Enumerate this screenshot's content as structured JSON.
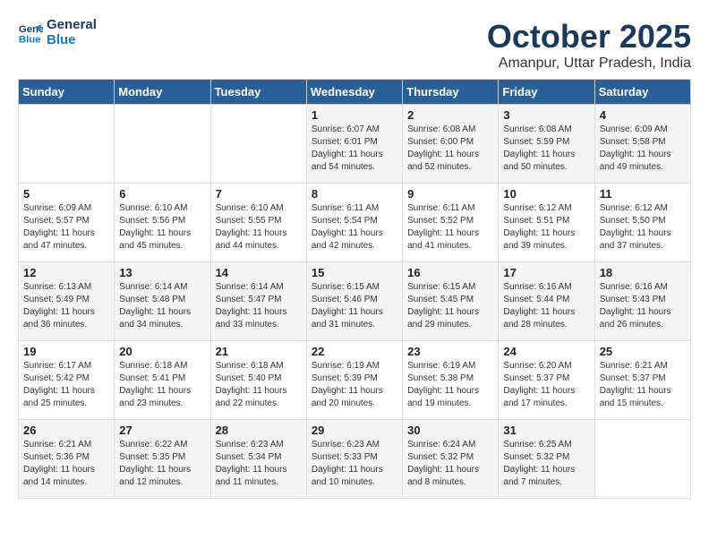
{
  "header": {
    "logo_line1": "General",
    "logo_line2": "Blue",
    "title": "October 2025",
    "subtitle": "Amanpur, Uttar Pradesh, India"
  },
  "days_of_week": [
    "Sunday",
    "Monday",
    "Tuesday",
    "Wednesday",
    "Thursday",
    "Friday",
    "Saturday"
  ],
  "weeks": [
    [
      {
        "day": "",
        "content": ""
      },
      {
        "day": "",
        "content": ""
      },
      {
        "day": "",
        "content": ""
      },
      {
        "day": "1",
        "content": "Sunrise: 6:07 AM\nSunset: 6:01 PM\nDaylight: 11 hours\nand 54 minutes."
      },
      {
        "day": "2",
        "content": "Sunrise: 6:08 AM\nSunset: 6:00 PM\nDaylight: 11 hours\nand 52 minutes."
      },
      {
        "day": "3",
        "content": "Sunrise: 6:08 AM\nSunset: 5:59 PM\nDaylight: 11 hours\nand 50 minutes."
      },
      {
        "day": "4",
        "content": "Sunrise: 6:09 AM\nSunset: 5:58 PM\nDaylight: 11 hours\nand 49 minutes."
      }
    ],
    [
      {
        "day": "5",
        "content": "Sunrise: 6:09 AM\nSunset: 5:57 PM\nDaylight: 11 hours\nand 47 minutes."
      },
      {
        "day": "6",
        "content": "Sunrise: 6:10 AM\nSunset: 5:56 PM\nDaylight: 11 hours\nand 45 minutes."
      },
      {
        "day": "7",
        "content": "Sunrise: 6:10 AM\nSunset: 5:55 PM\nDaylight: 11 hours\nand 44 minutes."
      },
      {
        "day": "8",
        "content": "Sunrise: 6:11 AM\nSunset: 5:54 PM\nDaylight: 11 hours\nand 42 minutes."
      },
      {
        "day": "9",
        "content": "Sunrise: 6:11 AM\nSunset: 5:52 PM\nDaylight: 11 hours\nand 41 minutes."
      },
      {
        "day": "10",
        "content": "Sunrise: 6:12 AM\nSunset: 5:51 PM\nDaylight: 11 hours\nand 39 minutes."
      },
      {
        "day": "11",
        "content": "Sunrise: 6:12 AM\nSunset: 5:50 PM\nDaylight: 11 hours\nand 37 minutes."
      }
    ],
    [
      {
        "day": "12",
        "content": "Sunrise: 6:13 AM\nSunset: 5:49 PM\nDaylight: 11 hours\nand 36 minutes."
      },
      {
        "day": "13",
        "content": "Sunrise: 6:14 AM\nSunset: 5:48 PM\nDaylight: 11 hours\nand 34 minutes."
      },
      {
        "day": "14",
        "content": "Sunrise: 6:14 AM\nSunset: 5:47 PM\nDaylight: 11 hours\nand 33 minutes."
      },
      {
        "day": "15",
        "content": "Sunrise: 6:15 AM\nSunset: 5:46 PM\nDaylight: 11 hours\nand 31 minutes."
      },
      {
        "day": "16",
        "content": "Sunrise: 6:15 AM\nSunset: 5:45 PM\nDaylight: 11 hours\nand 29 minutes."
      },
      {
        "day": "17",
        "content": "Sunrise: 6:16 AM\nSunset: 5:44 PM\nDaylight: 11 hours\nand 28 minutes."
      },
      {
        "day": "18",
        "content": "Sunrise: 6:16 AM\nSunset: 5:43 PM\nDaylight: 11 hours\nand 26 minutes."
      }
    ],
    [
      {
        "day": "19",
        "content": "Sunrise: 6:17 AM\nSunset: 5:42 PM\nDaylight: 11 hours\nand 25 minutes."
      },
      {
        "day": "20",
        "content": "Sunrise: 6:18 AM\nSunset: 5:41 PM\nDaylight: 11 hours\nand 23 minutes."
      },
      {
        "day": "21",
        "content": "Sunrise: 6:18 AM\nSunset: 5:40 PM\nDaylight: 11 hours\nand 22 minutes."
      },
      {
        "day": "22",
        "content": "Sunrise: 6:19 AM\nSunset: 5:39 PM\nDaylight: 11 hours\nand 20 minutes."
      },
      {
        "day": "23",
        "content": "Sunrise: 6:19 AM\nSunset: 5:38 PM\nDaylight: 11 hours\nand 19 minutes."
      },
      {
        "day": "24",
        "content": "Sunrise: 6:20 AM\nSunset: 5:37 PM\nDaylight: 11 hours\nand 17 minutes."
      },
      {
        "day": "25",
        "content": "Sunrise: 6:21 AM\nSunset: 5:37 PM\nDaylight: 11 hours\nand 15 minutes."
      }
    ],
    [
      {
        "day": "26",
        "content": "Sunrise: 6:21 AM\nSunset: 5:36 PM\nDaylight: 11 hours\nand 14 minutes."
      },
      {
        "day": "27",
        "content": "Sunrise: 6:22 AM\nSunset: 5:35 PM\nDaylight: 11 hours\nand 12 minutes."
      },
      {
        "day": "28",
        "content": "Sunrise: 6:23 AM\nSunset: 5:34 PM\nDaylight: 11 hours\nand 11 minutes."
      },
      {
        "day": "29",
        "content": "Sunrise: 6:23 AM\nSunset: 5:33 PM\nDaylight: 11 hours\nand 10 minutes."
      },
      {
        "day": "30",
        "content": "Sunrise: 6:24 AM\nSunset: 5:32 PM\nDaylight: 11 hours\nand 8 minutes."
      },
      {
        "day": "31",
        "content": "Sunrise: 6:25 AM\nSunset: 5:32 PM\nDaylight: 11 hours\nand 7 minutes."
      },
      {
        "day": "",
        "content": ""
      }
    ]
  ]
}
